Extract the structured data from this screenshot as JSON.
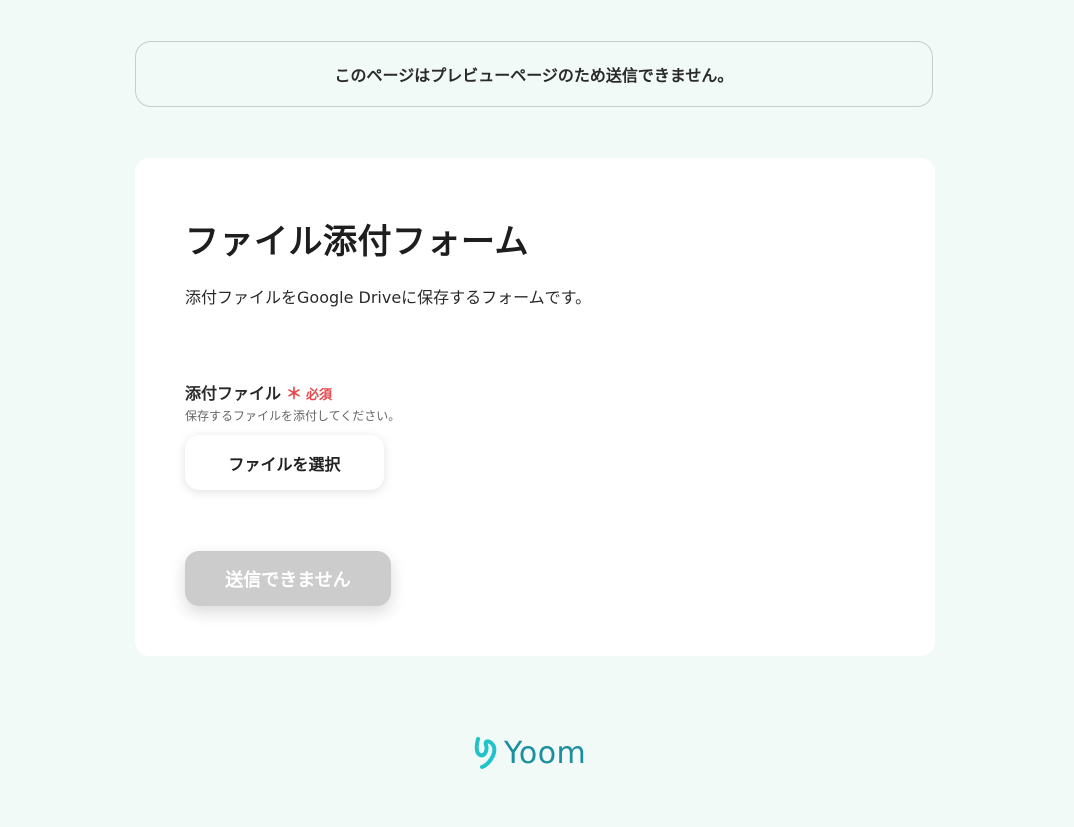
{
  "notice": {
    "text": "このページはプレビューページのため送信できません。"
  },
  "form": {
    "title": "ファイル添付フォーム",
    "description": "添付ファイルをGoogle Driveに保存するフォームです。",
    "fields": [
      {
        "label": "添付ファイル",
        "required_mark": "＊",
        "required_text": "必須",
        "help": "保存するファイルを添付してください。",
        "button_label": "ファイルを選択"
      }
    ],
    "submit_label": "送信できません"
  },
  "footer": {
    "logo_text": "Yoom",
    "logo_icon": "yoom-logo-icon",
    "brand_color": "#1b8fa0"
  }
}
